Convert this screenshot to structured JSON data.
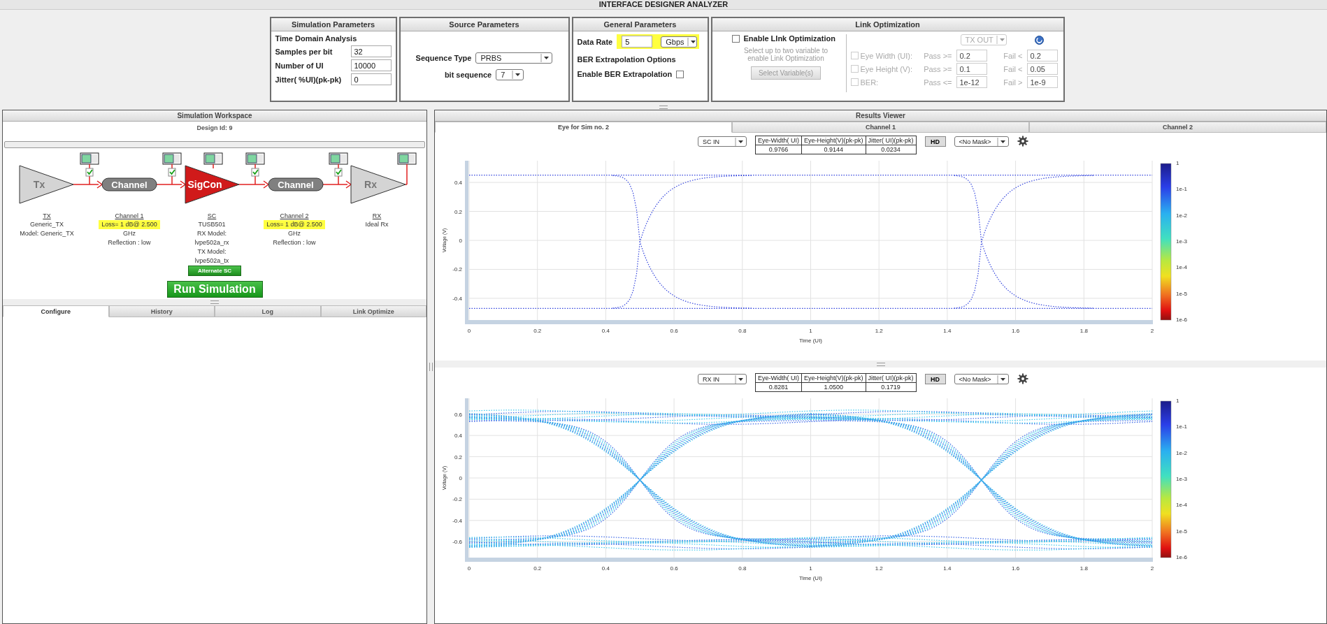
{
  "window": {
    "title": "INTERFACE DESIGNER ANALYZER"
  },
  "simulation_parameters": {
    "title": "Simulation Parameters",
    "section": "Time Domain Analysis",
    "fields": [
      {
        "label": "Samples per bit",
        "value": "32"
      },
      {
        "label": "Number of UI",
        "value": "10000"
      },
      {
        "label": "Jitter( %UI)(pk-pk)",
        "value": "0"
      }
    ]
  },
  "source_parameters": {
    "title": "Source Parameters",
    "fields": [
      {
        "label": "Sequence Type",
        "value": "PRBS",
        "kind": "wide"
      },
      {
        "label": "bit sequence",
        "value": "7",
        "kind": "narrow"
      }
    ]
  },
  "general_parameters": {
    "title": "General Parameters",
    "data_rate": {
      "label": "Data Rate",
      "value": "5",
      "unit": "Gbps",
      "highlighted": true
    },
    "section": "BER Extrapolation Options",
    "ber": {
      "label": "Enable BER Extrapolation",
      "checked": false
    }
  },
  "link_optimization": {
    "title": "Link Optimization",
    "enable": {
      "label": "Enable LInk Optimization",
      "checked": false
    },
    "hint": "Select up to two variable to enable Link Optimization",
    "button": "Select Variable(s)",
    "probe": "TX OUT",
    "criteria": [
      {
        "label": "Eye Width (UI):",
        "pass_label": "Pass >=",
        "pass": "0.2",
        "fail_label": "Fail <",
        "fail": "0.2",
        "checked": false
      },
      {
        "label": "Eye Height (V):",
        "pass_label": "Pass >=",
        "pass": "0.1",
        "fail_label": "Fail <",
        "fail": "0.05",
        "checked": false
      },
      {
        "label": "BER:",
        "pass_label": "Pass <=",
        "pass": "1e-12",
        "fail_label": "Fail >",
        "fail": "1e-9",
        "checked": false
      }
    ]
  },
  "workspace": {
    "title": "Simulation Workspace",
    "design_id": "Design Id: 9",
    "blocks": [
      {
        "kind": "triangle",
        "label": "Tx",
        "color": "#d4d4d4"
      },
      {
        "kind": "pill",
        "label": "Channel"
      },
      {
        "kind": "triangle",
        "label": "SigCon",
        "color": "#d01a1a"
      },
      {
        "kind": "pill",
        "label": "Channel"
      },
      {
        "kind": "triangle",
        "label": "Rx",
        "color": "#d4d4d4"
      }
    ],
    "probes": [
      {
        "checked": true
      },
      {
        "checked": true
      },
      {
        "checked": true
      },
      {
        "checked": true
      }
    ],
    "descriptions": [
      {
        "heading": "TX",
        "lines": [
          {
            "text": "Generic_TX",
            "highlighted": false
          },
          {
            "text": "Model: Generic_TX",
            "highlighted": false
          }
        ]
      },
      {
        "heading": "Channel 1",
        "lines": [
          {
            "text": "Loss= 1 dB@ 2.500",
            "highlighted": true
          },
          {
            "text": "GHz",
            "highlighted": false
          },
          {
            "text": "Reflection : low",
            "highlighted": false
          }
        ]
      },
      {
        "heading": "SC",
        "lines": [
          {
            "text": "TUSB501",
            "highlighted": false
          },
          {
            "text": "RX Model:",
            "highlighted": false
          },
          {
            "text": "lvpe502a_rx",
            "highlighted": false
          },
          {
            "text": "TX Model:",
            "highlighted": false
          },
          {
            "text": "lvpe502a_tx",
            "highlighted": false
          }
        ]
      },
      {
        "heading": "Channel 2",
        "lines": [
          {
            "text": "Loss= 1 dB@ 2.500",
            "highlighted": true
          },
          {
            "text": "GHz",
            "highlighted": false
          },
          {
            "text": "Reflection : low",
            "highlighted": false
          }
        ]
      },
      {
        "heading": "RX",
        "lines": [
          {
            "text": "Ideal Rx",
            "highlighted": false
          }
        ]
      }
    ],
    "alternate_button": "Alternate SC",
    "run_button": "Run Simulation",
    "tabs": [
      {
        "label": "Configure",
        "selected": true
      },
      {
        "label": "History",
        "selected": false
      },
      {
        "label": "Log",
        "selected": false
      },
      {
        "label": "Link Optimize",
        "selected": false
      }
    ]
  },
  "results": {
    "title": "Results Viewer",
    "tabs": [
      {
        "label": "Eye for Sim no. 2",
        "selected": true
      },
      {
        "label": "Channel 1",
        "selected": false
      },
      {
        "label": "Channel 2",
        "selected": false
      }
    ],
    "plots": [
      {
        "kind": "clean",
        "probe": "SC  IN",
        "metrics": [
          {
            "header": "Eye-Width( UI)",
            "value": "0.9766"
          },
          {
            "header": "Eye-Height(V)(pk-pk)",
            "value": "0.9144"
          },
          {
            "header": "Jitter( UI)(pk-pk)",
            "value": "0.0234"
          }
        ],
        "hd": "HD",
        "mask": "<No Mask>",
        "ylabel": "Voltage (V)",
        "xlabel": "Time (UI)",
        "yticks": [
          "0.4",
          "0.2",
          "0",
          "-0.2",
          "-0.4"
        ],
        "xticks": [
          "0",
          "0.2",
          "0.4",
          "0.6",
          "0.8",
          "1",
          "1.2",
          "1.4",
          "1.6",
          "1.8",
          "2"
        ],
        "colorbar": [
          "1",
          "1e-1",
          "1e-2",
          "1e-3",
          "1e-4",
          "1e-5",
          "1e-6"
        ]
      },
      {
        "kind": "noisy",
        "probe": "RX  IN",
        "metrics": [
          {
            "header": "Eye-Width( UI)",
            "value": "0.8281"
          },
          {
            "header": "Eye-Height(V)(pk-pk)",
            "value": "1.0500"
          },
          {
            "header": "Jitter( UI)(pk-pk)",
            "value": "0.1719"
          }
        ],
        "hd": "HD",
        "mask": "<No Mask>",
        "ylabel": "Voltage (V)",
        "xlabel": "Time (UI)",
        "yticks": [
          "0.6",
          "0.4",
          "0.2",
          "0",
          "-0.2",
          "-0.4",
          "-0.6"
        ],
        "xticks": [
          "0",
          "0.2",
          "0.4",
          "0.6",
          "0.8",
          "1",
          "1.2",
          "1.4",
          "1.6",
          "1.8",
          "2"
        ],
        "colorbar": [
          "1",
          "1e-1",
          "1e-2",
          "1e-3",
          "1e-4",
          "1e-5",
          "1e-6"
        ]
      }
    ]
  }
}
